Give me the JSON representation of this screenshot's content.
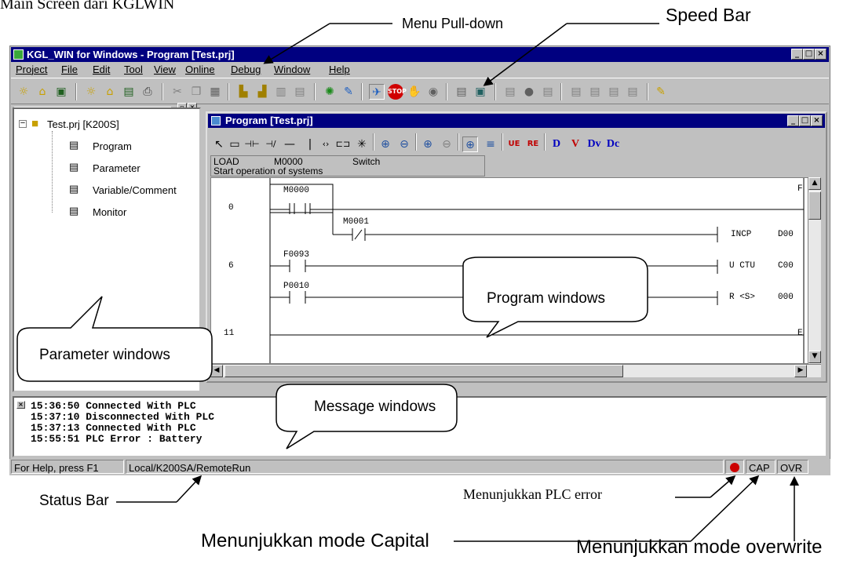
{
  "heading": "Main Screen dari KGLWIN",
  "annotations": {
    "menu_pulldown": "Menu Pull-down",
    "speed_bar": "Speed Bar",
    "program_windows": "Program windows",
    "parameter_windows": "Parameter windows",
    "message_windows": "Message windows",
    "status_bar": "Status Bar",
    "plc_error": "Menunjukkan PLC  error",
    "mode_capital": "Menunjukkan mode Capital",
    "mode_overwrite": "Menunjukkan mode overwrite"
  },
  "window": {
    "title": "KGL_WIN for Windows - Program [Test.prj]",
    "controls": [
      "_",
      "□",
      "×"
    ]
  },
  "menu": [
    "Project",
    "File",
    "Edit",
    "Tool",
    "View",
    "Online",
    "Debug",
    "Window",
    "Help"
  ],
  "tree": {
    "root": "Test.prj [K200S]",
    "items": [
      "Program",
      "Parameter",
      "Variable/Comment",
      "Monitor"
    ]
  },
  "program": {
    "title": "Program [Test.prj]",
    "info_row1": [
      "LOAD",
      "M0000",
      "Switch"
    ],
    "info_row2": "Start operation of systems",
    "steps": [
      "0",
      "6",
      "11"
    ],
    "contacts": [
      "M0000",
      "M0001",
      "F0093",
      "P0010"
    ],
    "coils": [
      "INCP",
      "D00",
      "U CTU",
      "C00",
      "R <S>",
      "000",
      "F",
      "E"
    ]
  },
  "messages": [
    "15:36:50 Connected With PLC",
    "15:37:10 Disconnected With PLC",
    "15:37:13 Connected With PLC",
    "15:55:51 PLC Error : Battery"
  ],
  "status": {
    "help": "For Help, press F1",
    "mode": "Local/K200SA/RemoteRun",
    "cap": "CAP",
    "ovr": "OVR"
  },
  "colors": {
    "titlebar": "#000080",
    "face": "#c0c0c0",
    "error": "#cc0000"
  }
}
